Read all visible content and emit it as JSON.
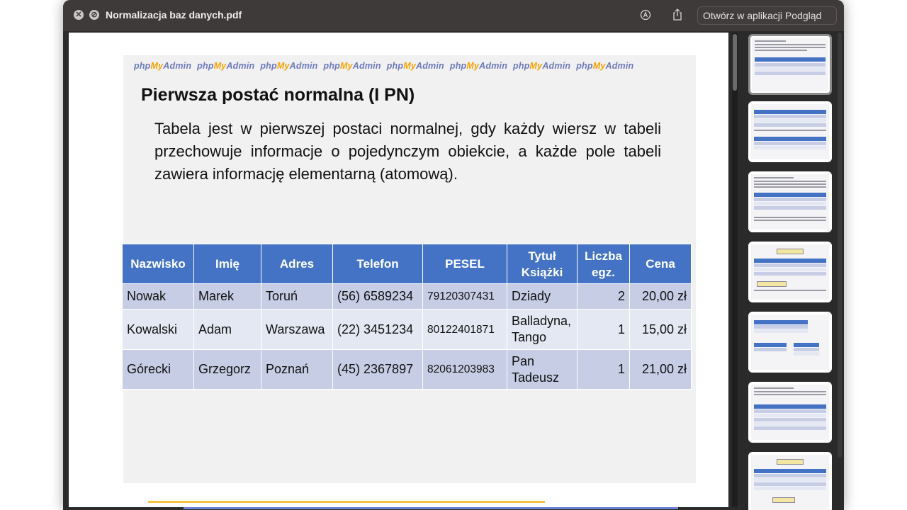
{
  "window": {
    "title": "Normalizacja baz danych.pdf",
    "close_glyph": "✕",
    "stop_glyph": "⊘",
    "open_in_button": "Otwórz w aplikacji Podgląd",
    "markup_icon": "markup-pen-icon",
    "share_icon": "share-icon"
  },
  "slide": {
    "banner_repeat": [
      "php",
      "My",
      "Admin"
    ],
    "title": "Pierwsza postać normalna (I PN)",
    "body": "Tabela jest w pierwszej postaci normalnej, gdy każdy wiersz w tabeli przechowuje informacje o pojedynczym obiekcie, a każde pole tabeli zawiera informację elementarną (atomową).",
    "table": {
      "headers": [
        "Nazwisko",
        "Imię",
        "Adres",
        "Telefon",
        "PESEL",
        "Tytuł Książki",
        "Liczba egz.",
        "Cena"
      ],
      "rows": [
        [
          "Nowak",
          "Marek",
          "Toruń",
          "(56) 6589234",
          "79120307431",
          "Dziady",
          "2",
          "20,00 zł"
        ],
        [
          "Kowalski",
          "Adam",
          "Warszawa",
          "(22) 3451234",
          "80122401871",
          "Balladyna, Tango",
          "1",
          "15,00 zł"
        ],
        [
          "Górecki",
          "Grzegorz",
          "Poznań",
          "(45) 2367897",
          "82061203983",
          "Pan Tadeusz",
          "1",
          "21,00 zł"
        ]
      ]
    }
  },
  "colors": {
    "table_header": "#4472c4",
    "row_dark": "#c6cde4",
    "row_light": "#e3e8f2",
    "accent_yellow": "#f5c242",
    "accent_blue": "#6b7fd1"
  }
}
